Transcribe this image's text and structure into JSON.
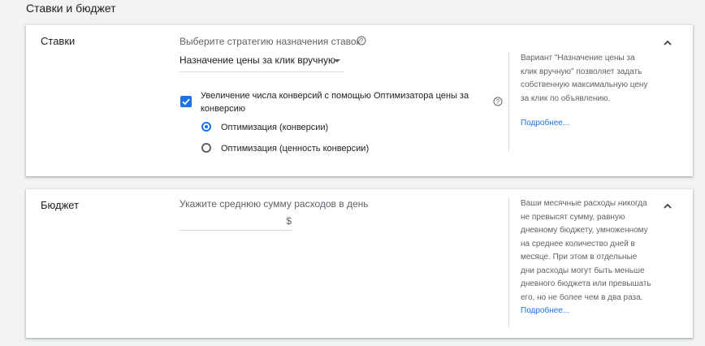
{
  "section": {
    "title": "Ставки и бюджет"
  },
  "bids": {
    "name": "Ставки",
    "strategy_prompt": "Выберите стратегию назначения ставок",
    "strategy_value": "Назначение цены за клик вручную",
    "conversion_checkbox": {
      "checked": true,
      "label": "Увеличение числа конверсий с помощью Оптимизатора цены за конверсию"
    },
    "radios": [
      {
        "label": "Оптимизация (конверсии)",
        "selected": true
      },
      {
        "label": "Оптимизация (ценность конверсии)",
        "selected": false
      }
    ],
    "side_note": "Вариант \"Назначение цены за клик вручную\" позволяет задать собственную максимальную цену за клик по объявлению.",
    "more_link": "Подробнее..."
  },
  "budget": {
    "name": "Бюджет",
    "prompt": "Укажите среднюю сумму расходов в день",
    "input_value": "",
    "currency": "$",
    "side_note": "Ваши месячные расходы никогда не превысят сумму, равную дневному бюджету, умноженному на среднее количество дней в месяце. При этом в отдельные дни расходы могут быть меньше дневного бюджета или превышать его, но не более чем в два раза.",
    "more_link": "Подробнее..."
  },
  "icons": {
    "help": "help-circle-icon",
    "collapse": "chevron-up-icon",
    "dropdown": "caret-down-icon",
    "check": "check-icon"
  },
  "colors": {
    "accent": "#1a73e8",
    "text": "#202124",
    "secondary_text": "#5f6368",
    "divider": "#dadce0",
    "background": "#f1f3f4"
  }
}
